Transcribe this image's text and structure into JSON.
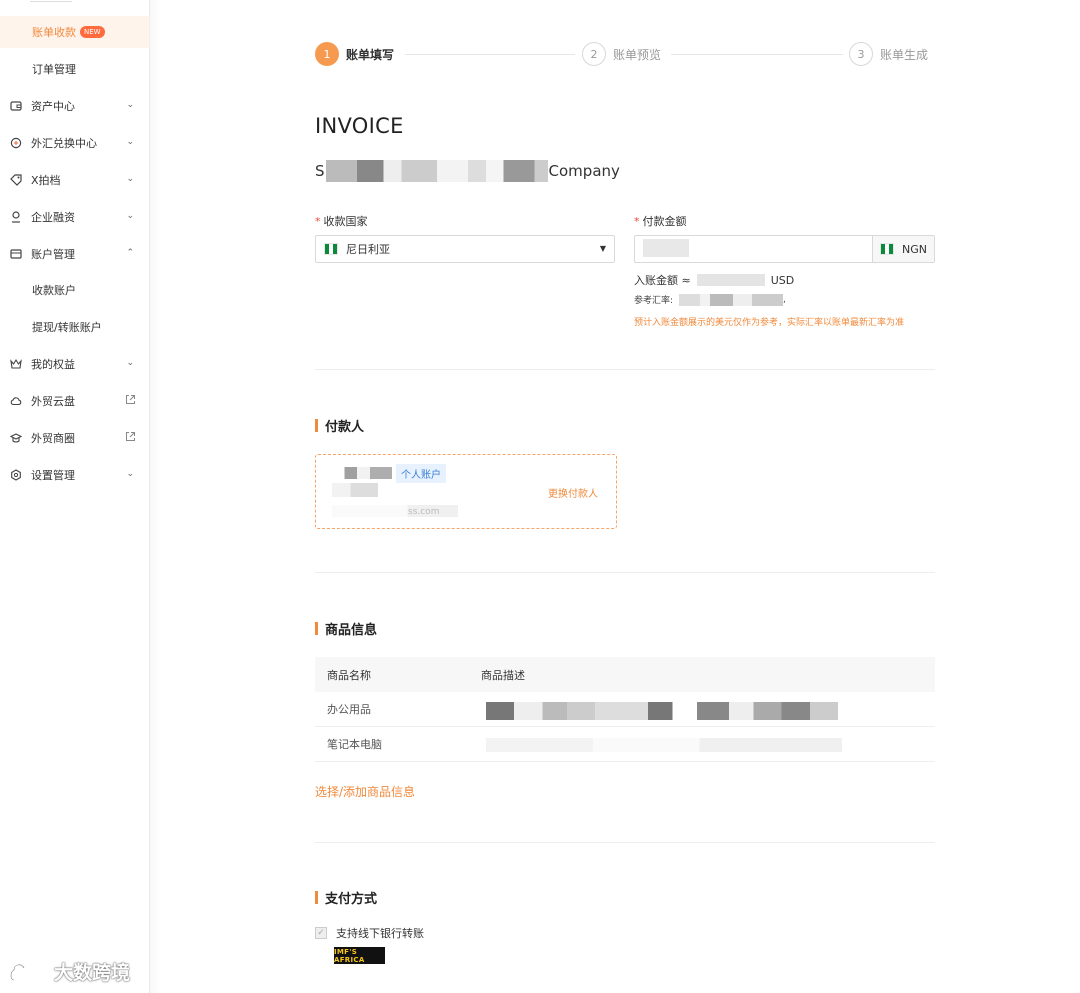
{
  "sidebar": {
    "items": [
      {
        "label": "账单收款",
        "badge": "NEW",
        "active": true,
        "sub": true
      },
      {
        "label": "订单管理",
        "sub": true
      },
      {
        "label": "资产中心",
        "icon": "wallet-icon",
        "chevron": "down"
      },
      {
        "label": "外汇兑换中心",
        "icon": "exchange-icon",
        "chevron": "down"
      },
      {
        "label": "X拍档",
        "icon": "tag-icon",
        "chevron": "down"
      },
      {
        "label": "企业融资",
        "icon": "finance-icon",
        "chevron": "down"
      },
      {
        "label": "账户管理",
        "icon": "card-icon",
        "chevron": "up"
      },
      {
        "label": "收款账户",
        "sub": true
      },
      {
        "label": "提现/转账账户",
        "sub": true
      },
      {
        "label": "我的权益",
        "icon": "crown-icon",
        "chevron": "down"
      },
      {
        "label": "外贸云盘",
        "icon": "cloud-icon",
        "external": true
      },
      {
        "label": "外贸商圈",
        "icon": "graduation-icon",
        "external": true
      },
      {
        "label": "设置管理",
        "icon": "settings-icon",
        "chevron": "down"
      }
    ]
  },
  "steps": [
    {
      "num": "1",
      "label": "账单填写",
      "state": "active"
    },
    {
      "num": "2",
      "label": "账单预览",
      "state": "todo"
    },
    {
      "num": "3",
      "label": "账单生成",
      "state": "todo"
    }
  ],
  "invoice": {
    "title": "INVOICE",
    "company_prefix": "S",
    "company_suffix": "Company"
  },
  "form": {
    "country_label": "收款国家",
    "country_value": "尼日利亚",
    "amount_label": "付款金额",
    "amount_currency": "NGN",
    "arrival_label": "入账金额 ≈",
    "arrival_currency": "USD",
    "rate_label": "参考汇率:",
    "rate_suffix": ",",
    "note": "预计入账金额展示的美元仅作为参考，实际汇率以账单最新汇率为准"
  },
  "payer": {
    "title": "付款人",
    "tag": "个人账户",
    "email_fragment": "ss.com",
    "change_label": "更换付款人"
  },
  "goods": {
    "title": "商品信息",
    "headers": [
      "商品名称",
      "商品描述"
    ],
    "rows": [
      {
        "name": "办公用品"
      },
      {
        "name": "笔记本电脑"
      }
    ],
    "add_label": "选择/添加商品信息"
  },
  "payment": {
    "title": "支付方式",
    "option_label": "支持线下银行转账",
    "logo_text": "IMF'S AFRICA"
  },
  "watermark": {
    "text": "大数跨境"
  },
  "colors": {
    "accent": "#f08a3c",
    "link_blue": "#3a7fd5"
  }
}
